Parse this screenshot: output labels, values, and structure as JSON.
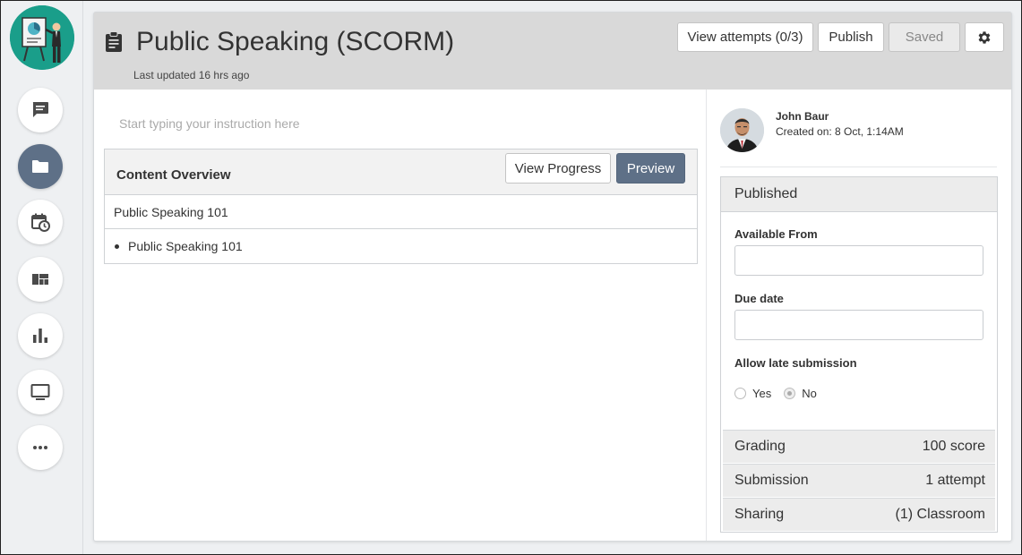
{
  "rail": {
    "items": [
      {
        "icon": "chat-icon",
        "active": false
      },
      {
        "icon": "folder-icon",
        "active": true
      },
      {
        "icon": "calendar-clock-icon",
        "active": false
      },
      {
        "icon": "dashboard-icon",
        "active": false
      },
      {
        "icon": "bar-chart-icon",
        "active": false
      },
      {
        "icon": "monitor-icon",
        "active": false
      },
      {
        "icon": "more-icon",
        "active": false
      }
    ]
  },
  "header": {
    "title": "Public Speaking (SCORM)",
    "subtitle": "Last updated 16 hrs ago",
    "view_attempts_label": "View attempts (0/3)",
    "publish_label": "Publish",
    "saved_label": "Saved"
  },
  "main": {
    "instruction_placeholder": "Start typing your instruction here",
    "overview": {
      "title": "Content Overview",
      "view_progress_label": "View Progress",
      "preview_label": "Preview",
      "rows": [
        "Public Speaking 101",
        "Public Speaking 101"
      ]
    }
  },
  "author": {
    "name": "John Baur",
    "created": "Created on: 8 Oct, 1:14AM"
  },
  "panel": {
    "status": "Published",
    "available_from_label": "Available From",
    "available_from_value": "",
    "due_date_label": "Due date",
    "due_date_value": "",
    "late_label": "Allow late submission",
    "late_yes": "Yes",
    "late_no": "No",
    "late_selected": "No",
    "summary": [
      {
        "label": "Grading",
        "value": "100 score"
      },
      {
        "label": "Submission",
        "value": "1 attempt"
      },
      {
        "label": "Sharing",
        "value": "(1) Classroom"
      }
    ]
  },
  "colors": {
    "accent": "#5e7087",
    "brand": "#1a9e8a",
    "header_bg": "#d9d9d9"
  }
}
